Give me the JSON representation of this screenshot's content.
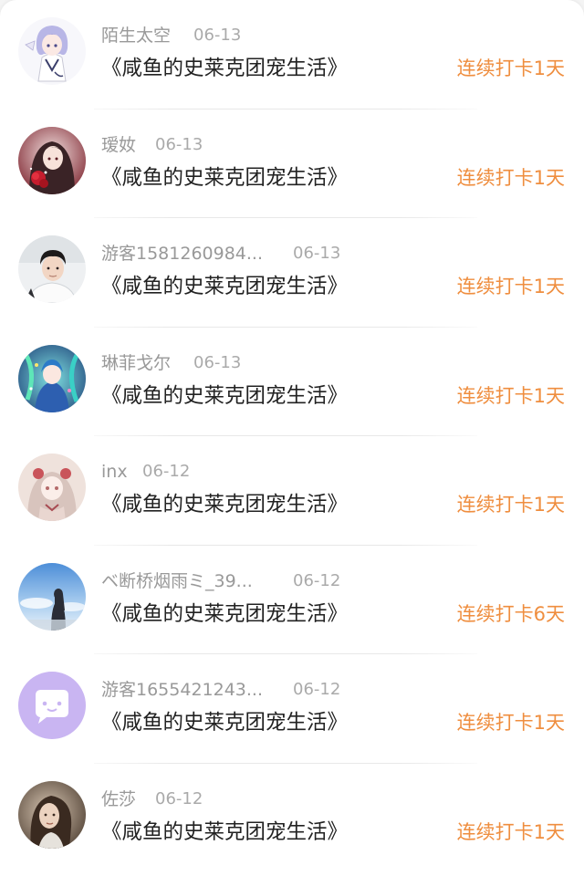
{
  "colors": {
    "accent": "#ef8e3f",
    "name_text": "#999999",
    "title_text": "#222222"
  },
  "entries": [
    {
      "name": "陌生太空",
      "date": "06-13",
      "book_title": "《咸鱼的史莱克团宠生活》",
      "streak": "连续打卡1天",
      "avatar_icon": "anime-girl-avatar"
    },
    {
      "name": "瑷奻",
      "date": "06-13",
      "book_title": "《咸鱼的史莱克团宠生活》",
      "streak": "连续打卡1天",
      "avatar_icon": "anime-girl-rose-avatar"
    },
    {
      "name": "游客1581260984...",
      "date": "06-13",
      "book_title": "《咸鱼的史莱克团宠生活》",
      "streak": "连续打卡1天",
      "avatar_icon": "young-man-photo-avatar"
    },
    {
      "name": "琳菲戈尔",
      "date": "06-13",
      "book_title": "《咸鱼的史莱克团宠生活》",
      "streak": "连续打卡1天",
      "avatar_icon": "anime-blue-girl-avatar"
    },
    {
      "name": "inx",
      "date": "06-12",
      "book_title": "《咸鱼的史莱克团宠生活》",
      "streak": "连续打卡1天",
      "avatar_icon": "anime-doll-avatar"
    },
    {
      "name": "ベ断桥烟雨ミ_39...",
      "date": "06-12",
      "book_title": "《咸鱼的史莱克团宠生活》",
      "streak": "连续打卡6天",
      "avatar_icon": "sky-silhouette-avatar"
    },
    {
      "name": "游客1655421243...",
      "date": "06-12",
      "book_title": "《咸鱼的史莱克团宠生活》",
      "streak": "连续打卡1天",
      "avatar_icon": "default-chat-avatar"
    },
    {
      "name": "佐莎",
      "date": "06-12",
      "book_title": "《咸鱼的史莱克团宠生活》",
      "streak": "连续打卡1天",
      "avatar_icon": "portrait-photo-avatar"
    }
  ]
}
